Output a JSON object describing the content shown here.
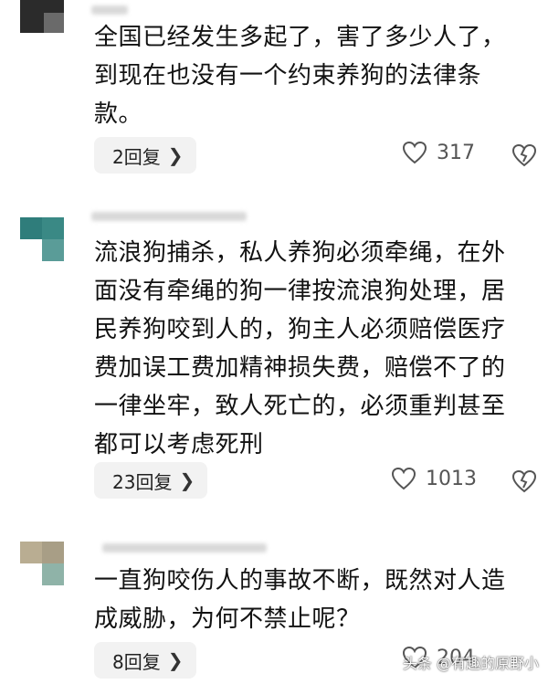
{
  "comments": [
    {
      "text": "全国已经发生多起了，害了多少人了，\n到现在也没有一个约束养狗的法律条\n款。",
      "replies_label": "2回复",
      "likes": "317",
      "avatar_colors": [
        "#2b2b2b",
        "#6a6a6a"
      ]
    },
    {
      "text": "流浪狗捕杀，私人养狗必须牵绳，在外\n面没有牵绳的狗一律按流浪狗处理，居\n民养狗咬到人的，狗主人必须赔偿医疗\n费加误工费加精神损失费，赔偿不了的\n一律坐牢，致人死亡的，必须重判甚至\n都可以考虑死刑",
      "replies_label": "23回复",
      "likes": "1013",
      "avatar_colors": [
        "#2f7d7b",
        "#5a9c98"
      ]
    },
    {
      "text": "一直狗咬伤人的事故不断，既然对人造\n成威胁，为何不禁止呢？",
      "replies_label": "8回复",
      "likes": "204",
      "avatar_colors": [
        "#b9ad92",
        "#8fb3a8"
      ]
    }
  ],
  "watermark": "头条 @有趣的原野小"
}
